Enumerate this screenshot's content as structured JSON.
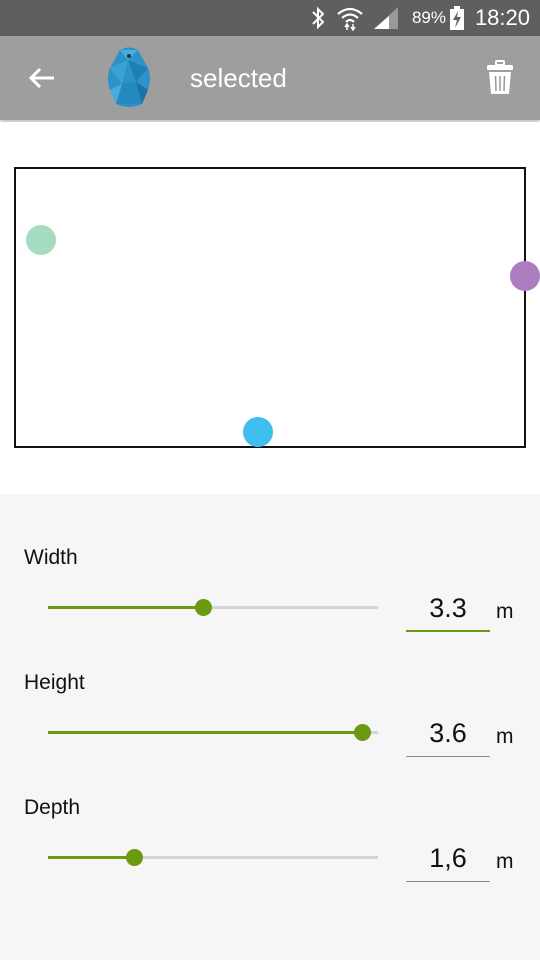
{
  "status_bar": {
    "time": "18:20",
    "battery": "89%",
    "icons": [
      "bluetooth-icon",
      "wifi-icon",
      "signal-icon",
      "battery-charging-icon"
    ]
  },
  "app_bar": {
    "title": "selected",
    "back_icon": "arrow-left-icon",
    "beacon_icon": "beacon-icon",
    "delete_icon": "trash-icon",
    "color": "#9e9e9e"
  },
  "room": {
    "beacons": [
      {
        "name": "mint",
        "color": "#a3dcc1"
      },
      {
        "name": "purple",
        "color": "#ad7dc1"
      },
      {
        "name": "blue",
        "color": "#3ebff0"
      }
    ]
  },
  "controls": {
    "accent_color": "#6a9a11",
    "items": [
      {
        "label": "Width",
        "value": "3.3",
        "unit": "m",
        "level": 0.47
      },
      {
        "label": "Height",
        "value": "3.6",
        "unit": "m",
        "level": 0.95
      },
      {
        "label": "Depth",
        "value": "1,6",
        "unit": "m",
        "level": 0.26
      }
    ]
  }
}
